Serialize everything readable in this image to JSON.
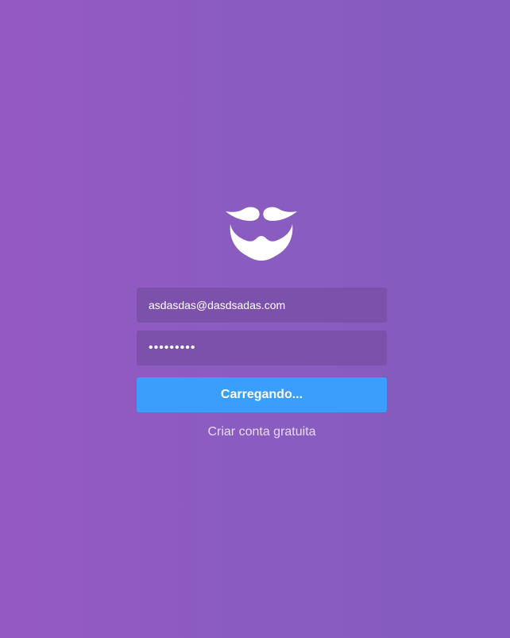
{
  "logo": {
    "icon": "mustache-beard-icon"
  },
  "form": {
    "email_value": "asdasdas@dasdsadas.com",
    "password_value": "aaaaaaaaa",
    "submit_label": "Carregando...",
    "signup_link": "Criar conta gratuita"
  },
  "colors": {
    "background_start": "#9559c2",
    "background_end": "#835ac0",
    "input_background": "#7c51ac",
    "button": "#3a9efc",
    "text": "#ffffff"
  }
}
